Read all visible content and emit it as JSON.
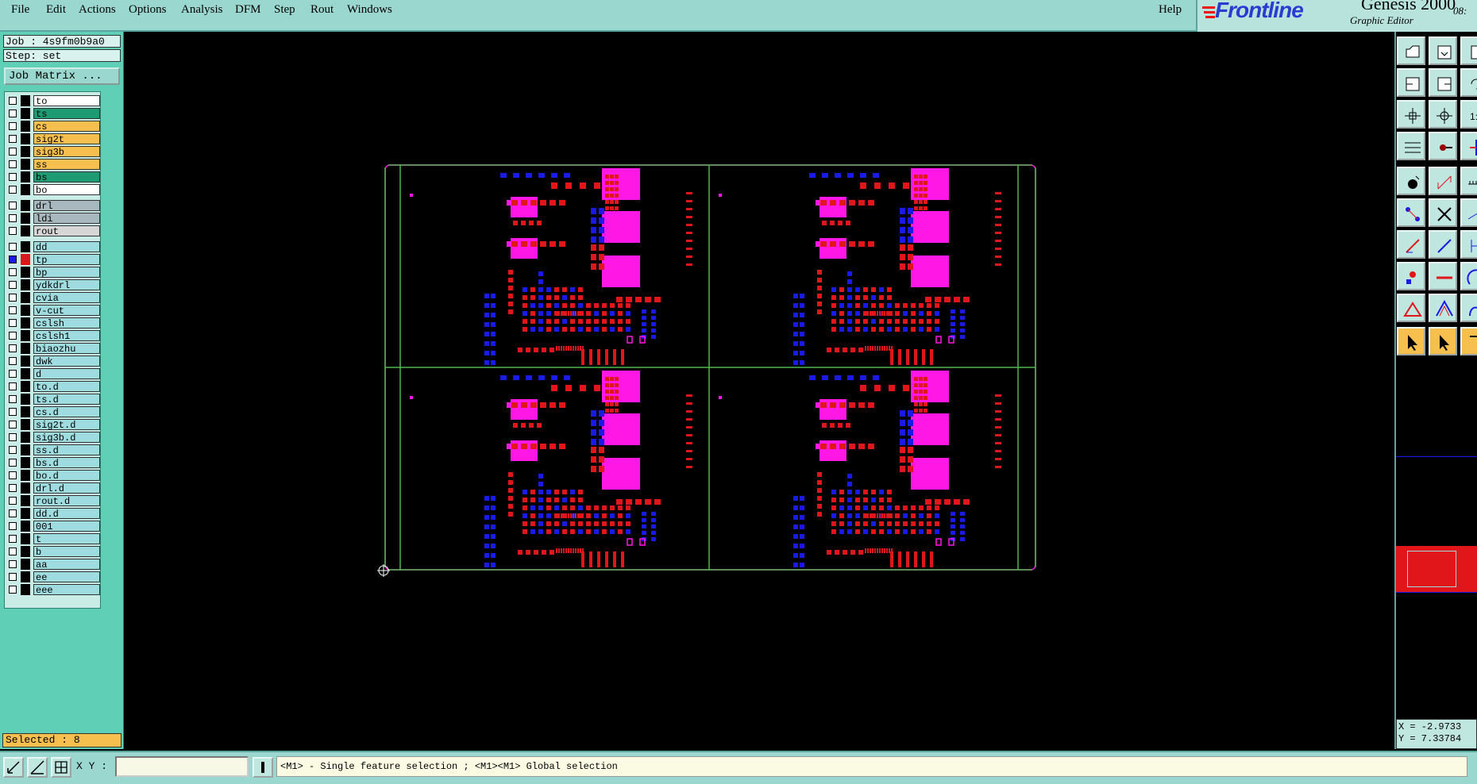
{
  "menu": {
    "items": [
      "File",
      "Edit",
      "Actions",
      "Options",
      "Analysis",
      "DFM",
      "Step",
      "Rout",
      "Windows"
    ],
    "help": "Help"
  },
  "brand": {
    "logo": "Frontline",
    "product": "Genesis 2000",
    "subtitle": "Graphic Editor",
    "time_fragment": "08:"
  },
  "job": {
    "job_line": "Job : 4s9fm0b9a0",
    "step_line": "Step: set",
    "matrix_button": "Job Matrix ..."
  },
  "colors": {
    "layer_white": "#ffffff",
    "layer_green": "#1f9b73",
    "layer_orange": "#f7c04e",
    "layer_gray": "#a9b8be",
    "layer_light": "#d6d6d6",
    "layer_cyan": "#9fdce0",
    "copper_red": "#e0161a",
    "copper_blue": "#1a1ae6",
    "pad_magenta": "#ff17e6",
    "profile_green": "#4fb84a"
  },
  "layers": [
    {
      "name": "to",
      "color": "layer_white"
    },
    {
      "name": "ts",
      "color": "layer_green"
    },
    {
      "name": "cs",
      "color": "layer_orange"
    },
    {
      "name": "sig2t",
      "color": "layer_orange"
    },
    {
      "name": "sig3b",
      "color": "layer_orange"
    },
    {
      "name": "ss",
      "color": "layer_orange"
    },
    {
      "name": "bs",
      "color": "layer_green"
    },
    {
      "name": "bo",
      "color": "layer_white"
    },
    {
      "name": "drl",
      "color": "layer_gray"
    },
    {
      "name": "ldi",
      "color": "layer_gray"
    },
    {
      "name": "rout",
      "color": "layer_light"
    },
    {
      "name": "dd",
      "color": "layer_cyan"
    },
    {
      "name": "tp",
      "color": "layer_cyan",
      "active": true
    },
    {
      "name": "bp",
      "color": "layer_cyan"
    },
    {
      "name": "ydkdrl",
      "color": "layer_cyan"
    },
    {
      "name": "cvia",
      "color": "layer_cyan"
    },
    {
      "name": "v-cut",
      "color": "layer_cyan"
    },
    {
      "name": "cslsh",
      "color": "layer_cyan"
    },
    {
      "name": "cslsh1",
      "color": "layer_cyan"
    },
    {
      "name": "biaozhu",
      "color": "layer_cyan"
    },
    {
      "name": "dwk",
      "color": "layer_cyan"
    },
    {
      "name": "d",
      "color": "layer_cyan"
    },
    {
      "name": "to.d",
      "color": "layer_cyan"
    },
    {
      "name": "ts.d",
      "color": "layer_cyan"
    },
    {
      "name": "cs.d",
      "color": "layer_cyan"
    },
    {
      "name": "sig2t.d",
      "color": "layer_cyan"
    },
    {
      "name": "sig3b.d",
      "color": "layer_cyan"
    },
    {
      "name": "ss.d",
      "color": "layer_cyan"
    },
    {
      "name": "bs.d",
      "color": "layer_cyan"
    },
    {
      "name": "bo.d",
      "color": "layer_cyan"
    },
    {
      "name": "drl.d",
      "color": "layer_cyan"
    },
    {
      "name": "rout.d",
      "color": "layer_cyan"
    },
    {
      "name": "dd.d",
      "color": "layer_cyan"
    },
    {
      "name": "001",
      "color": "layer_cyan"
    },
    {
      "name": "t",
      "color": "layer_cyan"
    },
    {
      "name": "b",
      "color": "layer_cyan"
    },
    {
      "name": "aa",
      "color": "layer_cyan"
    },
    {
      "name": "ee",
      "color": "layer_cyan"
    },
    {
      "name": "eee",
      "color": "layer_cyan"
    }
  ],
  "selection": {
    "text": "Selected : 8"
  },
  "coords": {
    "x_text": "X = -2.9733",
    "y_text": "Y = 7.33784"
  },
  "status": {
    "xy_label": "X Y :",
    "xy_value": "",
    "hint": "<M1> - Single feature selection ; <M1><M1> Global selection"
  },
  "tools": [
    "load-icon",
    "save-icon",
    "copy-icon",
    "open-left-icon",
    "open-right-icon",
    "rotate-icon",
    "fit-icon",
    "zoom-center-icon",
    "one-to-one-icon",
    "measure-icon",
    "pen-icon",
    "snap-icon",
    "camera-icon",
    "edit-shape-icon",
    "ruler-icon",
    "net-icon",
    "cross-icon",
    "line-icon",
    "draw-line-icon",
    "draw-segment-icon",
    "route-icon",
    "point-icon",
    "dash-icon",
    "arc-icon",
    "triangle-icon",
    "polygon-icon",
    "curve-icon",
    "arrow-select-icon",
    "arrow-select-alt-icon",
    "lasso-icon"
  ]
}
